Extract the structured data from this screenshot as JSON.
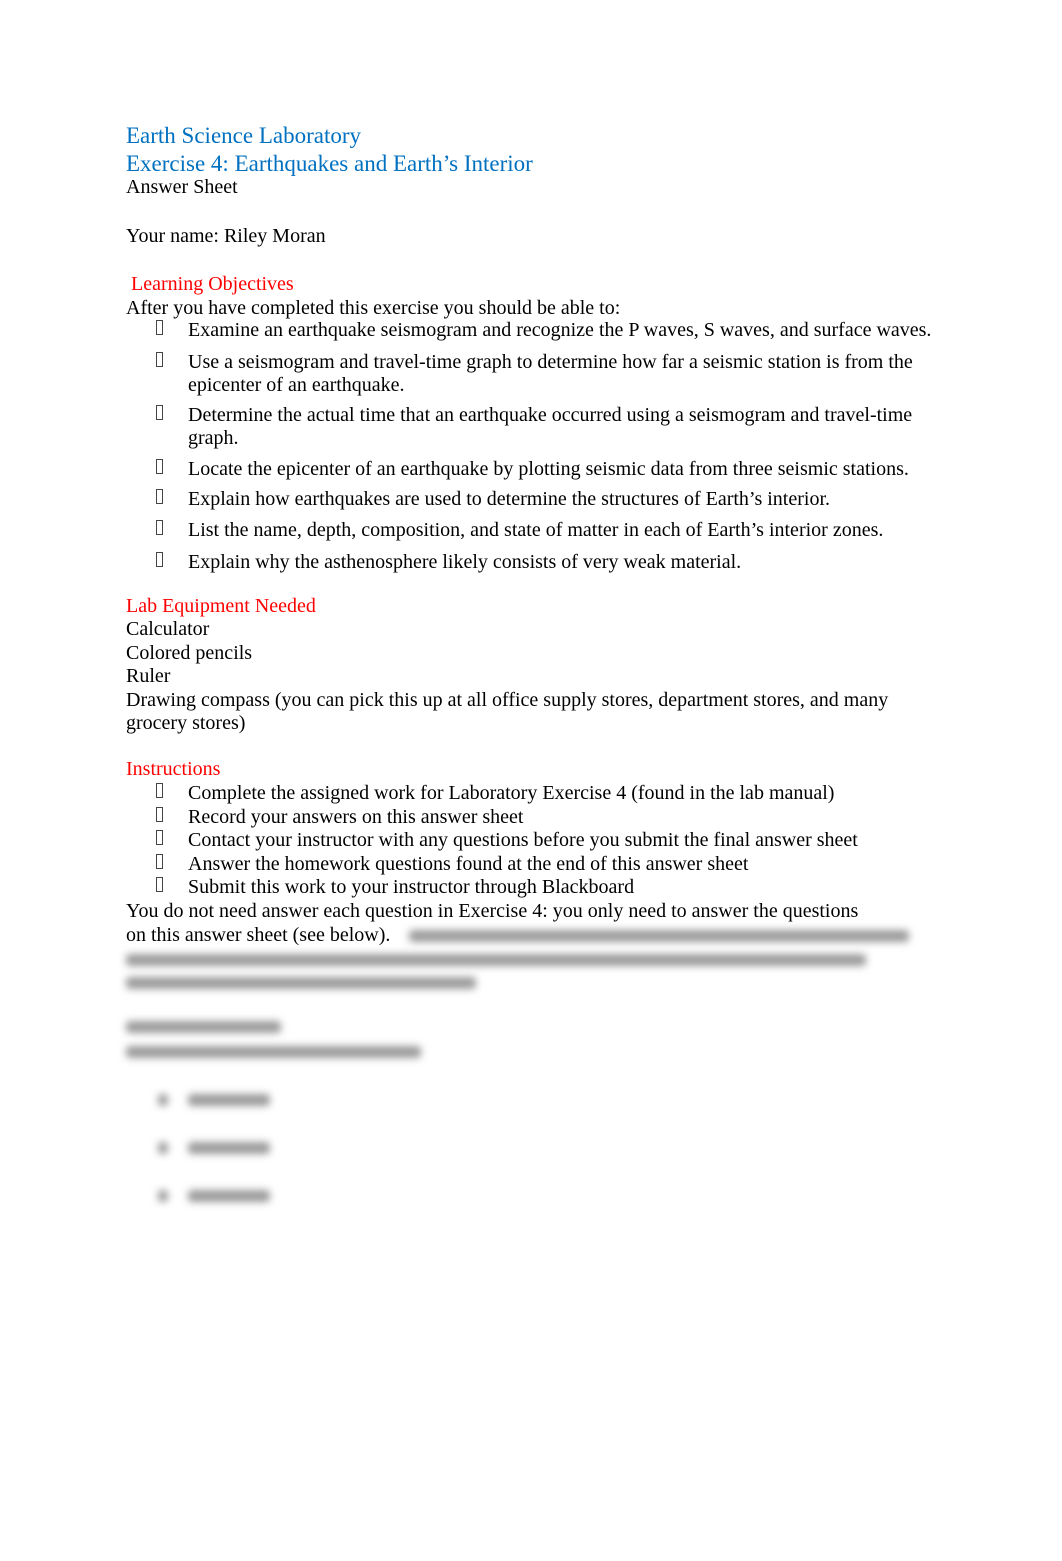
{
  "header": {
    "course_title": "Earth Science Laboratory",
    "exercise_title": "Exercise 4: Earthquakes and Earth’s Interior",
    "subtitle": "Answer Sheet",
    "name_line": "Your name: Riley Moran"
  },
  "learning_objectives": {
    "heading": "Learning Objectives",
    "intro": "After you have completed this exercise you should be able to:",
    "bullet_icon": "missing-glyph-bullet",
    "items": [
      [
        "Examine an earthquake seismogram and recognize the P waves, S waves, and surface waves."
      ],
      [
        "Use a seismogram and travel-time graph to determine how far a seismic station is from the",
        "epicenter of an earthquake."
      ],
      [
        "Determine the actual time that an earthquake occurred using a seismogram and travel-time",
        "graph."
      ],
      [
        "Locate the epicenter of an earthquake by plotting seismic data from three seismic stations."
      ],
      [
        "Explain how earthquakes are used to determine the structures of Earth’s interior."
      ],
      [
        "List the name, depth, composition, and state of matter in each of Earth’s interior zones."
      ],
      [
        "Explain why the asthenosphere likely consists of very weak material."
      ]
    ]
  },
  "lab_equipment": {
    "heading": "Lab Equipment Needed",
    "items": [
      "Calculator",
      "Colored pencils",
      "Ruler",
      "Drawing compass (you can pick this up at all office supply stores, department stores, and many",
      "grocery stores)"
    ]
  },
  "instructions": {
    "heading": "Instructions",
    "items": [
      "Complete the assigned work for Laboratory Exercise 4 (found in the lab manual)",
      "Record your answers on this answer sheet",
      "Contact your instructor with any questions before you submit the final answer sheet",
      "Answer the homework questions found at the end of this answer sheet",
      "Submit this work to your instructor through Blackboard"
    ],
    "note_line1": "You do not need answer each question in Exercise 4: you only need to answer the questions",
    "note_line2": "on this answer sheet (see below)."
  },
  "colors": {
    "title_blue": "#0070C0",
    "heading_red": "#FF0000"
  }
}
